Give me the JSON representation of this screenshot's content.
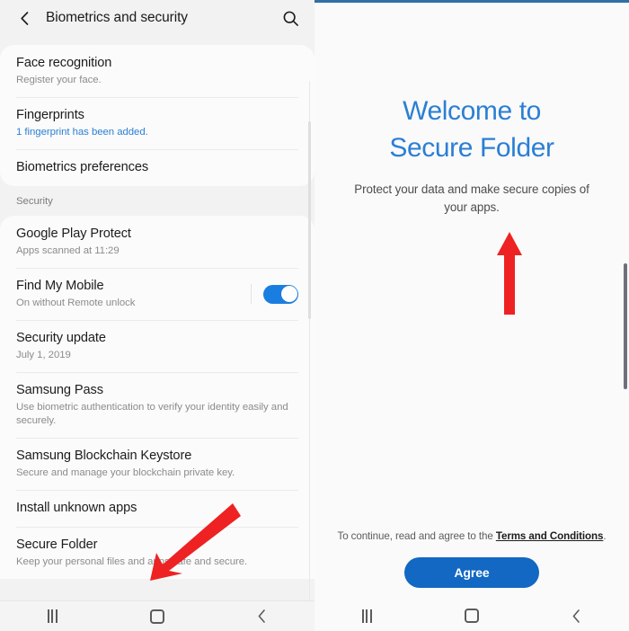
{
  "left_panel": {
    "appbar": {
      "back_icon": "chevron-left-icon",
      "title": "Biometrics and security",
      "search_icon": "search-icon"
    },
    "groups": [
      {
        "section_label": null,
        "items": [
          {
            "title": "Face recognition",
            "subtitle": "Register your face.",
            "subtitle_accent": false,
            "toggle": null
          },
          {
            "title": "Fingerprints",
            "subtitle": "1 fingerprint has been added.",
            "subtitle_accent": true,
            "toggle": null
          },
          {
            "title": "Biometrics preferences",
            "subtitle": null,
            "subtitle_accent": false,
            "toggle": null
          }
        ]
      },
      {
        "section_label": "Security",
        "items": [
          {
            "title": "Google Play Protect",
            "subtitle": "Apps scanned at 11:29",
            "subtitle_accent": false,
            "toggle": null
          },
          {
            "title": "Find My Mobile",
            "subtitle": "On without Remote unlock",
            "subtitle_accent": false,
            "toggle": "on"
          },
          {
            "title": "Security update",
            "subtitle": "July 1, 2019",
            "subtitle_accent": false,
            "toggle": null
          },
          {
            "title": "Samsung Pass",
            "subtitle": "Use biometric authentication to verify your identity easily and securely.",
            "subtitle_accent": false,
            "toggle": null
          },
          {
            "title": "Samsung Blockchain Keystore",
            "subtitle": "Secure and manage your blockchain private key.",
            "subtitle_accent": false,
            "toggle": null
          },
          {
            "title": "Install unknown apps",
            "subtitle": null,
            "subtitle_accent": false,
            "toggle": null
          },
          {
            "title": "Secure Folder",
            "subtitle": "Keep your personal files and apps safe and secure.",
            "subtitle_accent": false,
            "toggle": null
          }
        ]
      }
    ],
    "navbar": {
      "recents_label": "recents-icon",
      "home_label": "home-icon",
      "back_label": "back-icon"
    }
  },
  "right_panel": {
    "title_line1": "Welcome to",
    "title_line2": "Secure Folder",
    "subtitle": "Protect your data and make secure copies of your apps.",
    "terms_prefix": "To continue, read and agree to the ",
    "terms_link": "Terms and Conditions",
    "terms_suffix": ".",
    "agree_label": "Agree",
    "navbar": {
      "recents_label": "recents-icon",
      "home_label": "home-icon",
      "back_label": "back-icon"
    }
  },
  "annotations": {
    "arrow_color": "#ee2222",
    "arrow_up_name": "scroll-up-arrow-annotation",
    "arrow_diag_name": "secure-folder-pointer-arrow-annotation"
  },
  "theme": {
    "accent_blue": "#2b7fd4",
    "toggle_blue": "#1a7ee0",
    "button_blue": "#1268c3",
    "page_bg": "#f2f2f2",
    "card_bg": "#fbfbfb"
  }
}
